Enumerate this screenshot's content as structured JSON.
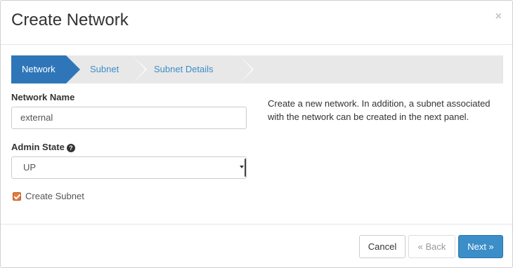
{
  "dialog": {
    "title": "Create Network",
    "close_symbol": "×"
  },
  "wizard": {
    "steps": [
      {
        "label": "Network",
        "active": true
      },
      {
        "label": "Subnet",
        "active": false
      },
      {
        "label": "Subnet Details",
        "active": false
      }
    ]
  },
  "form": {
    "network_name_label": "Network Name",
    "network_name_value": "external",
    "admin_state_label": "Admin State",
    "admin_state_help_icon": "question-circle-icon",
    "admin_state_selected": "UP",
    "create_subnet_label": "Create Subnet",
    "create_subnet_checked": true
  },
  "help_text": "Create a new network. In addition, a subnet associated with the network can be created in the next panel.",
  "footer": {
    "cancel_label": "Cancel",
    "back_label": "« Back",
    "next_label": "Next »"
  },
  "colors": {
    "active_step": "#2f76b9",
    "link": "#3b8ec8",
    "primary_button": "#3b8ec8",
    "checkbox": "#e8793c"
  }
}
